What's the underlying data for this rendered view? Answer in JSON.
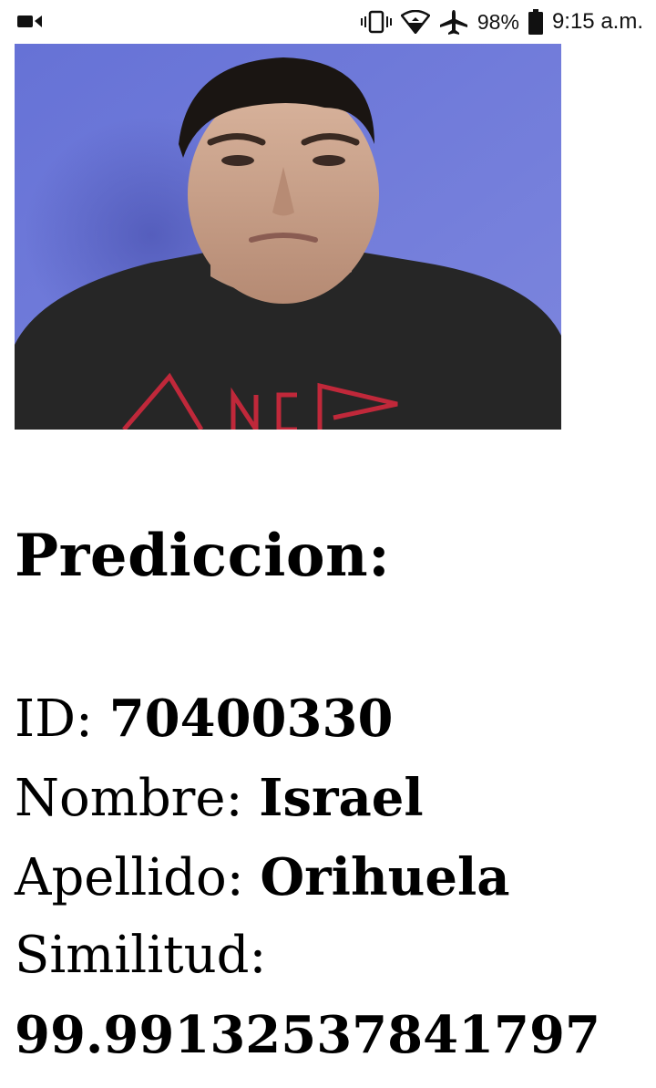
{
  "status_bar": {
    "left_icon": "video-camera-icon",
    "icons": [
      "vibrate-icon",
      "wifi-icon",
      "airplane-icon",
      "battery-icon"
    ],
    "battery_percent": "98%",
    "time": "9:15 a.m."
  },
  "photo": {
    "description_icon": "person-photo"
  },
  "prediction": {
    "title": "Prediccion:",
    "id_label": "ID: ",
    "id_value": "70400330",
    "nombre_label": "Nombre: ",
    "nombre_value": "Israel",
    "apellido_label": "Apellido: ",
    "apellido_value": "Orihuela",
    "similitud_label": "Similitud:",
    "similitud_value": "99.99132537841797"
  },
  "colors": {
    "background": "#ffffff",
    "text": "#000000",
    "photo_wall": "#6d77d6",
    "shirt": "#262626",
    "shirt_print": "#c0283a"
  }
}
